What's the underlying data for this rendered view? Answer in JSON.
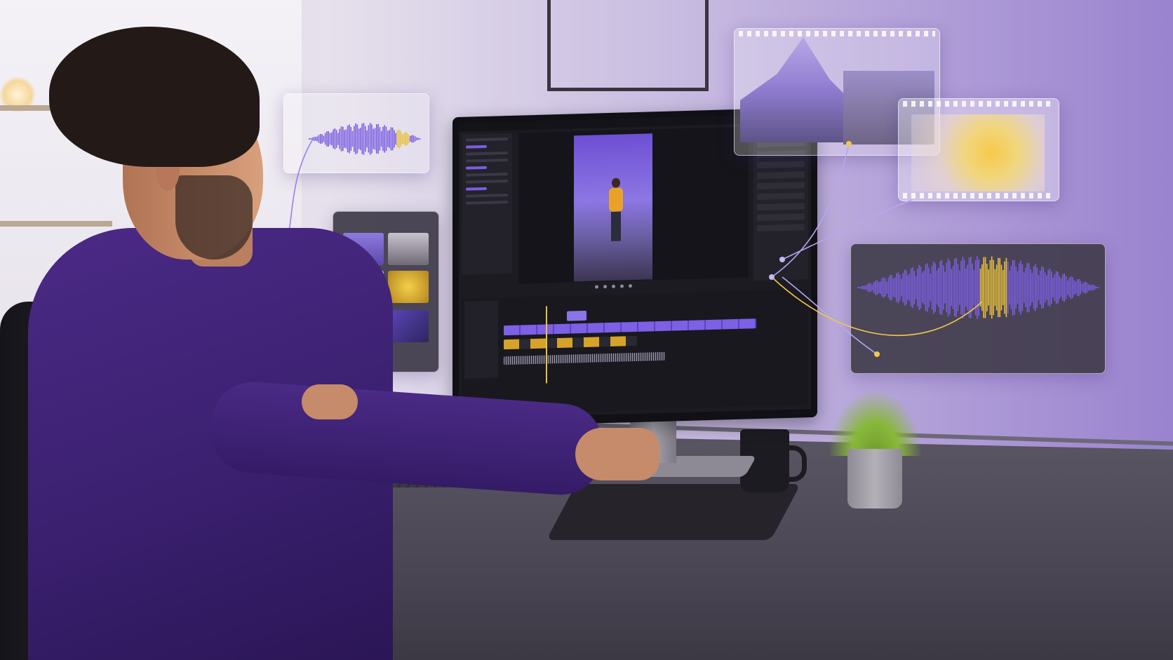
{
  "scene": {
    "accent": "#7b5ee0",
    "highlight": "#e7c23a",
    "wall_left": "#e6e1ec",
    "wall_right": "#9a83cf",
    "desk": "#4a4653"
  },
  "monitor": {
    "menu_items": [
      "",
      "",
      "",
      ""
    ],
    "app_title": ""
  },
  "icons": [
    "waveform-icon",
    "play-icon",
    "film-strip-icon"
  ]
}
